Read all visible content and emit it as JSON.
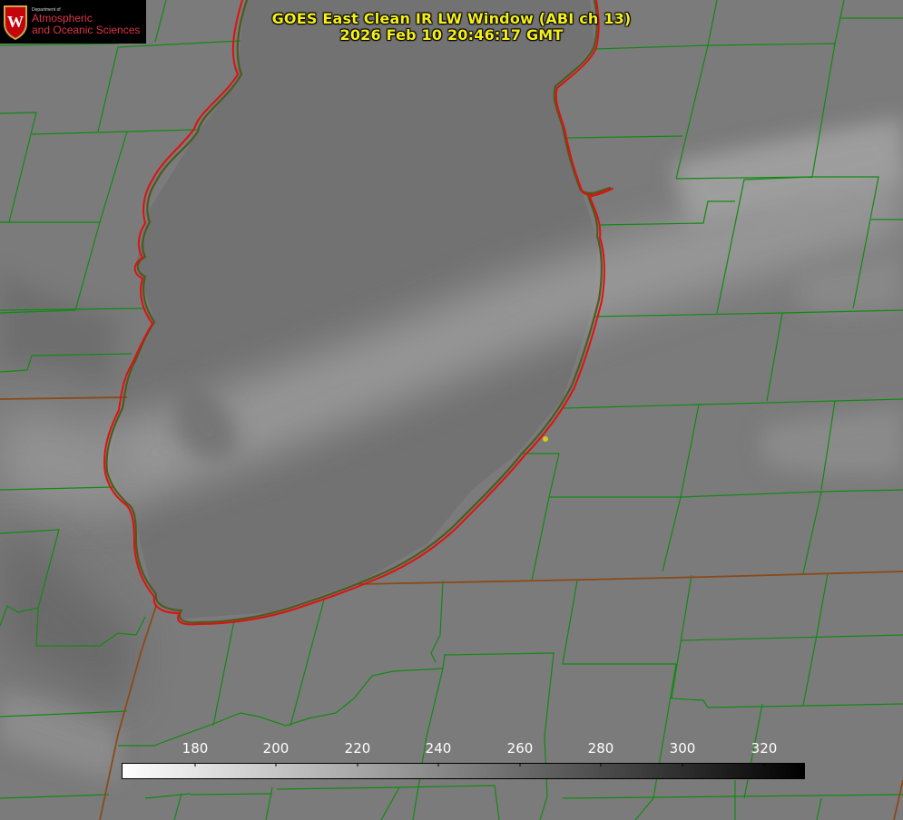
{
  "title": {
    "line1": "GOES East Clean IR LW Window (ABI ch 13)",
    "line2": "2026 Feb 10 20:46:17 GMT"
  },
  "logo": {
    "department": "Department of",
    "line1": "Atmospheric",
    "line2": "and Oceanic Sciences",
    "crest_letter": "W"
  },
  "colorbar": {
    "ticks": [
      "180",
      "200",
      "220",
      "240",
      "260",
      "280",
      "300",
      "320"
    ],
    "gradient_from": "#ffffff",
    "gradient_to": "#000000"
  },
  "colors": {
    "county_lines": "#118a11",
    "coastline": "#e01010",
    "state_line": "#8a4a1a",
    "marker": "#d8c81a",
    "title_text": "#f4ef1a"
  }
}
